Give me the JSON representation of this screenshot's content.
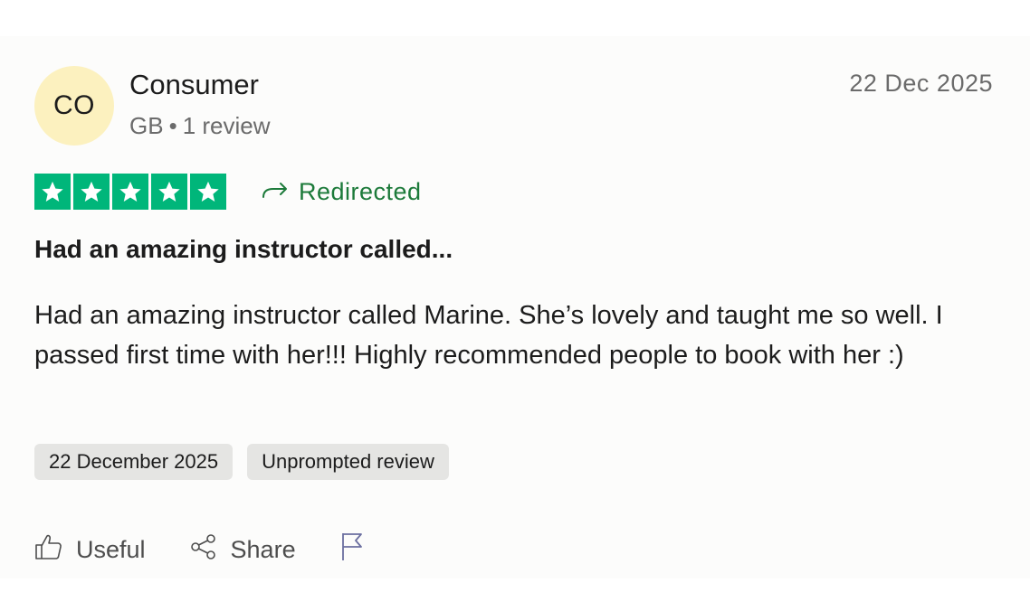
{
  "reviewer": {
    "initials": "CO",
    "name": "Consumer",
    "country": "GB",
    "separator": "•",
    "review_count": "1 review"
  },
  "review": {
    "date_short": "22 Dec 2025",
    "rating": 5,
    "rating_max": 5,
    "redirected_label": "Redirected",
    "title": "Had an amazing instructor called...",
    "text": "Had an amazing instructor called Marine. She’s lovely and taught me so well. I passed first time with her!!! Highly recommended people to book with her :)",
    "tags": [
      "22 December 2025",
      "Unprompted review"
    ]
  },
  "actions": {
    "useful_label": "Useful",
    "share_label": "Share"
  },
  "colors": {
    "star_green": "#00b67a",
    "redirected_green": "#1c7a3a",
    "avatar_bg": "#fcf1bf",
    "tag_bg": "#e5e5e3",
    "flag_color": "#6b6fa0"
  },
  "icons": {
    "star": "star-icon",
    "redirect": "redirect-arrow-icon",
    "useful": "thumbs-up-icon",
    "share": "share-icon",
    "report": "flag-icon"
  }
}
